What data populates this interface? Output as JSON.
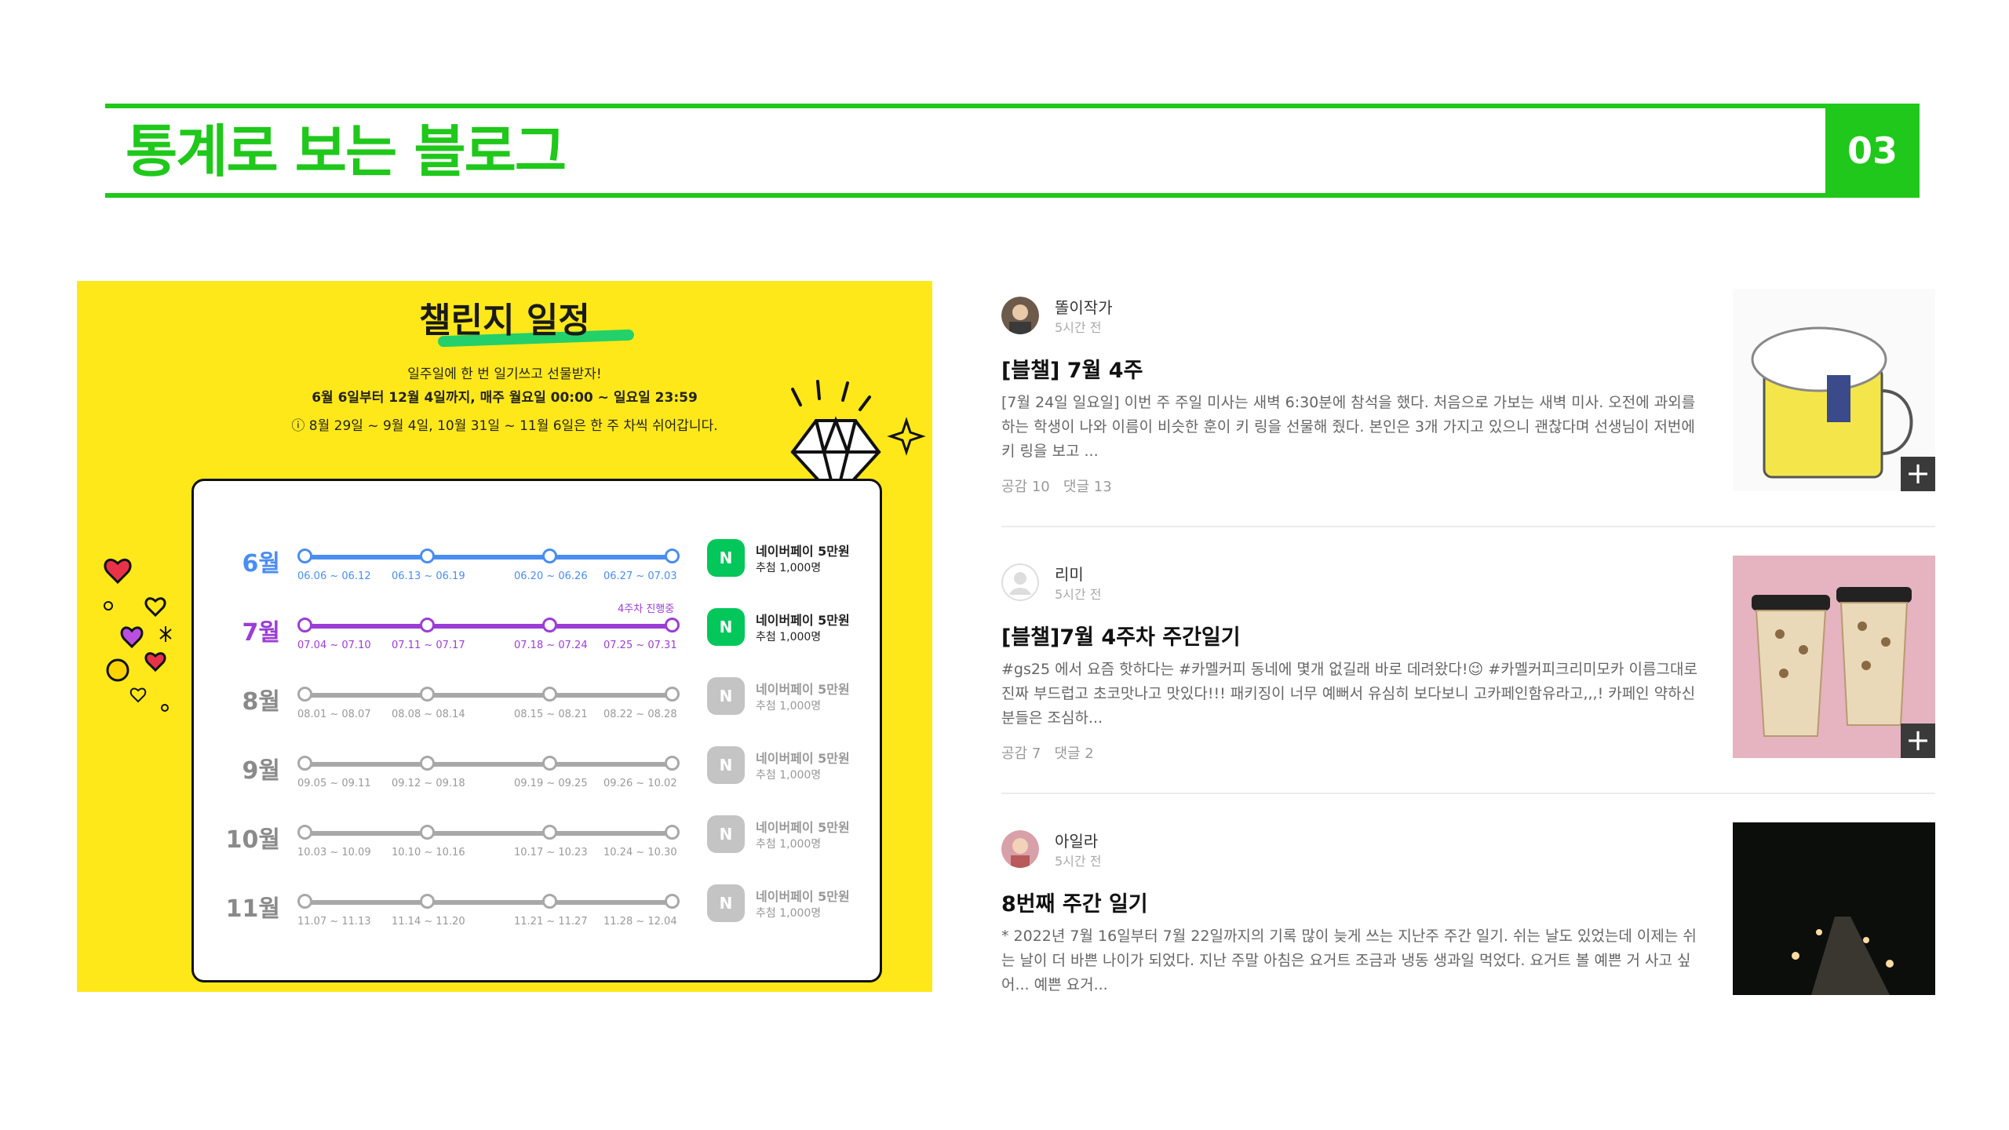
{
  "header": {
    "title": "통계로 보는 블로그",
    "page_number": "03"
  },
  "challenge": {
    "title": "챌린지 일정",
    "line1": "일주일에 한 번 일기쓰고 선물받자!",
    "line2": "6월 6일부터 12월 4일까지, 매주 월요일 00:00 ~ 일요일 23:59",
    "line3": "ⓘ 8월 29일 ~ 9월 4일, 10월 31일 ~ 11월 6일은 한 주 차씩 쉬어갑니다.",
    "in_progress": "4주차 진행중",
    "prize": "네이버페이 5만원",
    "draw": "추첨 1,000명",
    "badge": "N",
    "months": [
      {
        "label": "6월",
        "ranges": [
          "06.06 ~ 06.12",
          "06.13 ~ 06.19",
          "06.20 ~ 06.26",
          "06.27 ~ 07.03"
        ],
        "state": "done"
      },
      {
        "label": "7월",
        "ranges": [
          "07.04 ~ 07.10",
          "07.11 ~ 07.17",
          "07.18 ~ 07.24",
          "07.25 ~ 07.31"
        ],
        "state": "current"
      },
      {
        "label": "8월",
        "ranges": [
          "08.01 ~ 08.07",
          "08.08 ~ 08.14",
          "08.15 ~ 08.21",
          "08.22 ~ 08.28"
        ],
        "state": "upcoming"
      },
      {
        "label": "9월",
        "ranges": [
          "09.05 ~ 09.11",
          "09.12 ~ 09.18",
          "09.19 ~ 09.25",
          "09.26 ~ 10.02"
        ],
        "state": "upcoming"
      },
      {
        "label": "10월",
        "ranges": [
          "10.03 ~ 10.09",
          "10.10 ~ 10.16",
          "10.17 ~ 10.23",
          "10.24 ~ 10.30"
        ],
        "state": "upcoming"
      },
      {
        "label": "11월",
        "ranges": [
          "11.07 ~ 11.13",
          "11.14 ~ 11.20",
          "11.21 ~ 11.27",
          "11.28 ~ 12.04"
        ],
        "state": "upcoming"
      }
    ]
  },
  "colors": {
    "green": "#1fc81a",
    "blue": "#4a8df0",
    "purple": "#9b3dd6",
    "gray": "#a8a8a8",
    "yellow": "#ffe81a",
    "naver": "#03c75a"
  },
  "posts": [
    {
      "author": "똘이작가",
      "time": "5시간 전",
      "title": "[블챌] 7월 4주",
      "excerpt": "[7월 24일 일요일] 이번 주 주일 미사는 새벽 6:30분에 참석을 했다. 처음으로 가보는 새벽 미사. 오전에 과외를 하는 학생이 나와 이름이 비슷한 훈이 키 링을 선물해 줬다. 본인은 3개 가지고 있으니 괜찮다며 선생님이 저번에 키 링을 보고 ...",
      "likes": "공감 10",
      "comments": "댓글 13",
      "plus": "+"
    },
    {
      "author": "리미",
      "time": "5시간 전",
      "title": "[블챌]7월 4주차 주간일기",
      "excerpt": "#gs25 에서 요즘 핫하다는 #카멜커피 동네에 몇개 없길래 바로 데려왔다!😉 #카멜커피크리미모카 이름그대로 진짜 부드럽고 초코맛나고 맛있다!!! 패키징이 너무 예뻐서 유심히 보다보니 고카페인함유라고,,,! 카페인 약하신 분들은 조심하...",
      "likes": "공감 7",
      "comments": "댓글 2",
      "plus": "+"
    },
    {
      "author": "아일라",
      "time": "5시간 전",
      "title": "8번째 주간 일기",
      "excerpt": "* 2022년 7월 16일부터 7월 22일까지의 기록 많이 늦게 쓰는 지난주 주간 일기. 쉬는 날도 있었는데 이제는 쉬는 날이 더 바쁜 나이가 되었다. 지난 주말 아침은 요거트 조금과 냉동 생과일 먹었다. 요거트 볼 예쁜 거 사고 싶어... 예쁜 요거...",
      "likes": "",
      "comments": "",
      "plus": ""
    }
  ]
}
